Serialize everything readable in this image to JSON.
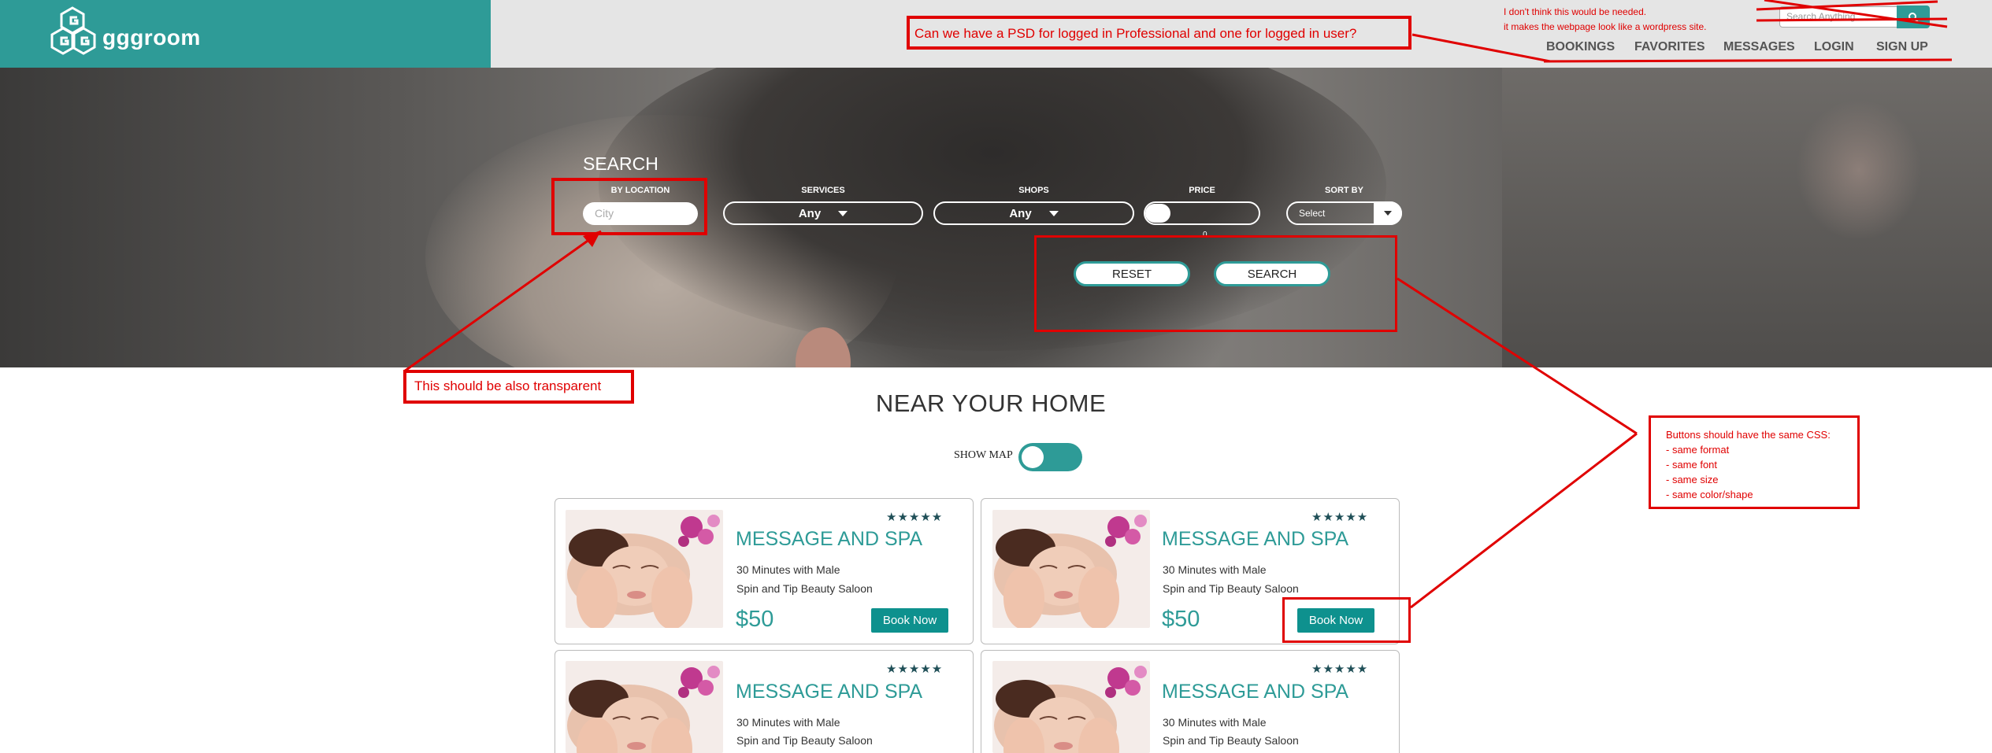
{
  "brand": {
    "name": "gggroom"
  },
  "header": {
    "search_placeholder": "Search Anything",
    "nav": [
      "BOOKINGS",
      "FAVORITES",
      "MESSAGES",
      "LOGIN",
      "SIGN UP"
    ]
  },
  "hero": {
    "title": "SEARCH",
    "filters": {
      "location_label": "BY LOCATION",
      "location_placeholder": "City",
      "services_label": "SERVICES",
      "services_value": "Any",
      "shops_label": "SHOPS",
      "shops_value": "Any",
      "price_label": "PRICE",
      "price_marker": "0",
      "sort_label": "SORT BY",
      "sort_value": "Select"
    },
    "reset_label": "RESET",
    "search_label": "SEARCH"
  },
  "main": {
    "section_title": "NEAR YOUR HOME",
    "show_map_label": "SHOW MAP",
    "show_map_on": true,
    "cards": [
      {
        "title": "MESSAGE AND SPA",
        "line1": "30 Minutes with Male",
        "line2": "Spin and Tip Beauty Saloon",
        "price": "$50",
        "cta": "Book Now",
        "rating": 5
      },
      {
        "title": "MESSAGE AND SPA",
        "line1": "30 Minutes with Male",
        "line2": "Spin and Tip Beauty Saloon",
        "price": "$50",
        "cta": "Book Now",
        "rating": 5
      },
      {
        "title": "MESSAGE AND SPA",
        "line1": "30 Minutes with Male",
        "line2": "Spin and Tip Beauty Saloon",
        "rating": 5
      },
      {
        "title": "MESSAGE AND SPA",
        "line1": "30 Minutes with Male",
        "line2": "Spin and Tip Beauty Saloon",
        "rating": 5
      }
    ]
  },
  "annotations": {
    "psd_note": "Can we have a PSD for logged in Professional and one for logged in user?",
    "search_note_line1": "I don't think this would be needed.",
    "search_note_line2": "it makes the webpage look like a wordpress site.",
    "transparent_note": "This should be also transparent",
    "buttons_note_title": "Buttons should have the same CSS:",
    "buttons_note_items": [
      "- same format",
      "- same font",
      "- same size",
      "- same color/shape"
    ]
  },
  "colors": {
    "brand": "#2e9b97",
    "annotation": "#e00000",
    "book_button": "#0e918e"
  }
}
